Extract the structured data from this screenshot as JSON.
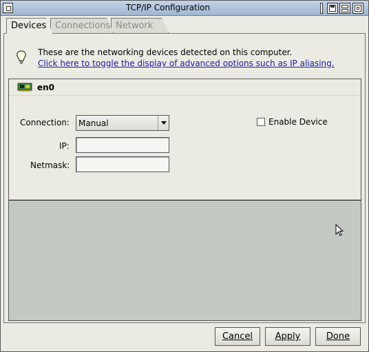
{
  "window": {
    "title": "TCP/IP Configuration"
  },
  "tabs": [
    {
      "label": "Devices",
      "active": true
    },
    {
      "label": "Connections",
      "active": false
    },
    {
      "label": "Network",
      "active": false
    }
  ],
  "info": {
    "icon": "lightbulb-icon",
    "message": "These are the networking devices detected on this computer.",
    "link_text": "Click here to toggle the display of advanced options such as IP aliasing."
  },
  "device": {
    "icon": "network-card-icon",
    "name": "en0",
    "connection_label": "Connection:",
    "connection_value": "Manual",
    "ip_label": "IP:",
    "ip_value": "",
    "netmask_label": "Netmask:",
    "netmask_value": "",
    "enable_label": "Enable Device",
    "enable_checked": false
  },
  "buttons": {
    "cancel": "Cancel",
    "apply": "Apply",
    "done": "Done"
  }
}
